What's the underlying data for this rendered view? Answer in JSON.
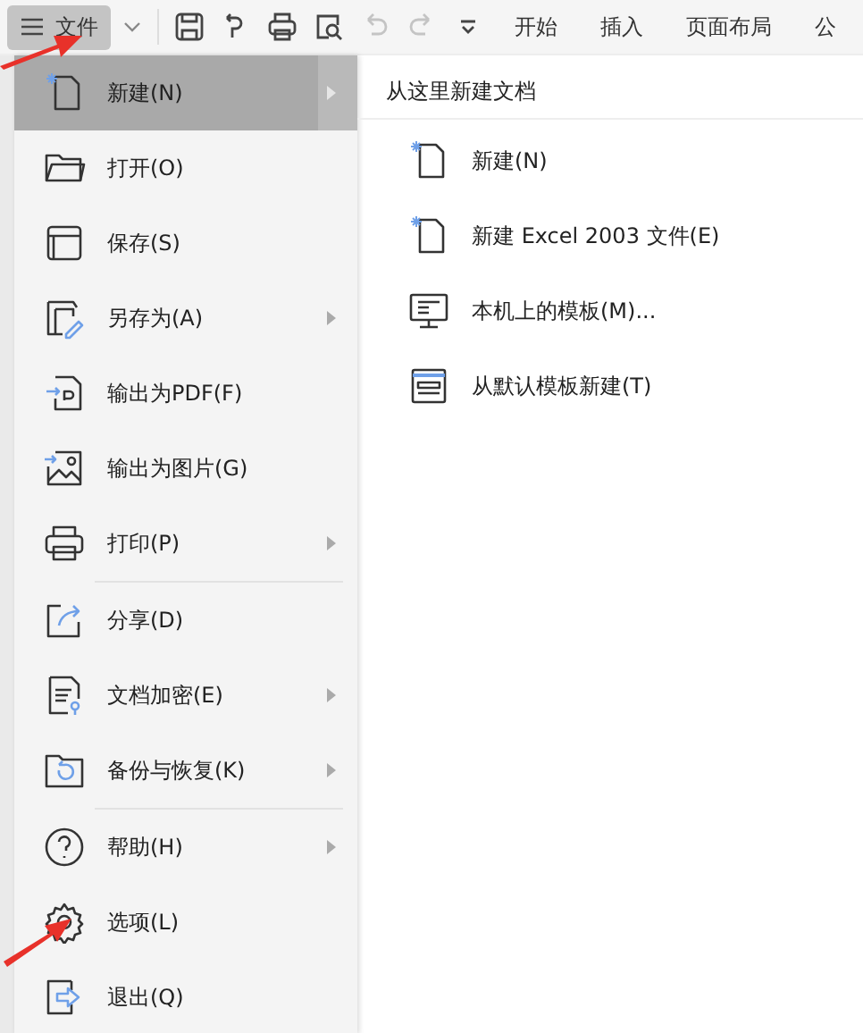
{
  "toolbar": {
    "file_menu": {
      "label": "文件",
      "selected": true
    },
    "quick_access": [
      {
        "disabled": false
      },
      {
        "disabled": false
      },
      {
        "disabled": false
      },
      {
        "disabled": false
      },
      {
        "disabled": true
      },
      {
        "disabled": true
      },
      {
        "disabled": false
      }
    ],
    "tabs": [
      {
        "label": "开始",
        "selected": false
      },
      {
        "label": "插入",
        "selected": false
      },
      {
        "label": "页面布局",
        "selected": false
      },
      {
        "label": "公",
        "selected": false
      }
    ]
  },
  "file_menu": {
    "groups": [
      [
        {
          "label": "新建(N)",
          "submenu": true,
          "selected": true
        },
        {
          "label": "打开(O)",
          "submenu": false,
          "selected": false
        },
        {
          "label": "保存(S)",
          "submenu": false,
          "selected": false
        },
        {
          "label": "另存为(A)",
          "submenu": true,
          "selected": false
        },
        {
          "label": "输出为PDF(F)",
          "submenu": false,
          "selected": false
        },
        {
          "label": "输出为图片(G)",
          "submenu": false,
          "selected": false
        },
        {
          "label": "打印(P)",
          "submenu": true,
          "selected": false
        }
      ],
      [
        {
          "label": "分享(D)",
          "submenu": false,
          "selected": false
        },
        {
          "label": "文档加密(E)",
          "submenu": true,
          "selected": false
        },
        {
          "label": "备份与恢复(K)",
          "submenu": true,
          "selected": false
        }
      ],
      [
        {
          "label": "帮助(H)",
          "submenu": true,
          "selected": false
        },
        {
          "label": "选项(L)",
          "submenu": false,
          "selected": false
        },
        {
          "label": "退出(Q)",
          "submenu": false,
          "selected": false
        }
      ]
    ]
  },
  "submenu": {
    "title": "从这里新建文档",
    "items": [
      {
        "label": "新建(N)"
      },
      {
        "label": "新建 Excel 2003 文件(E)"
      },
      {
        "label": "本机上的模板(M)..."
      },
      {
        "label": "从默认模板新建(T)"
      }
    ]
  }
}
